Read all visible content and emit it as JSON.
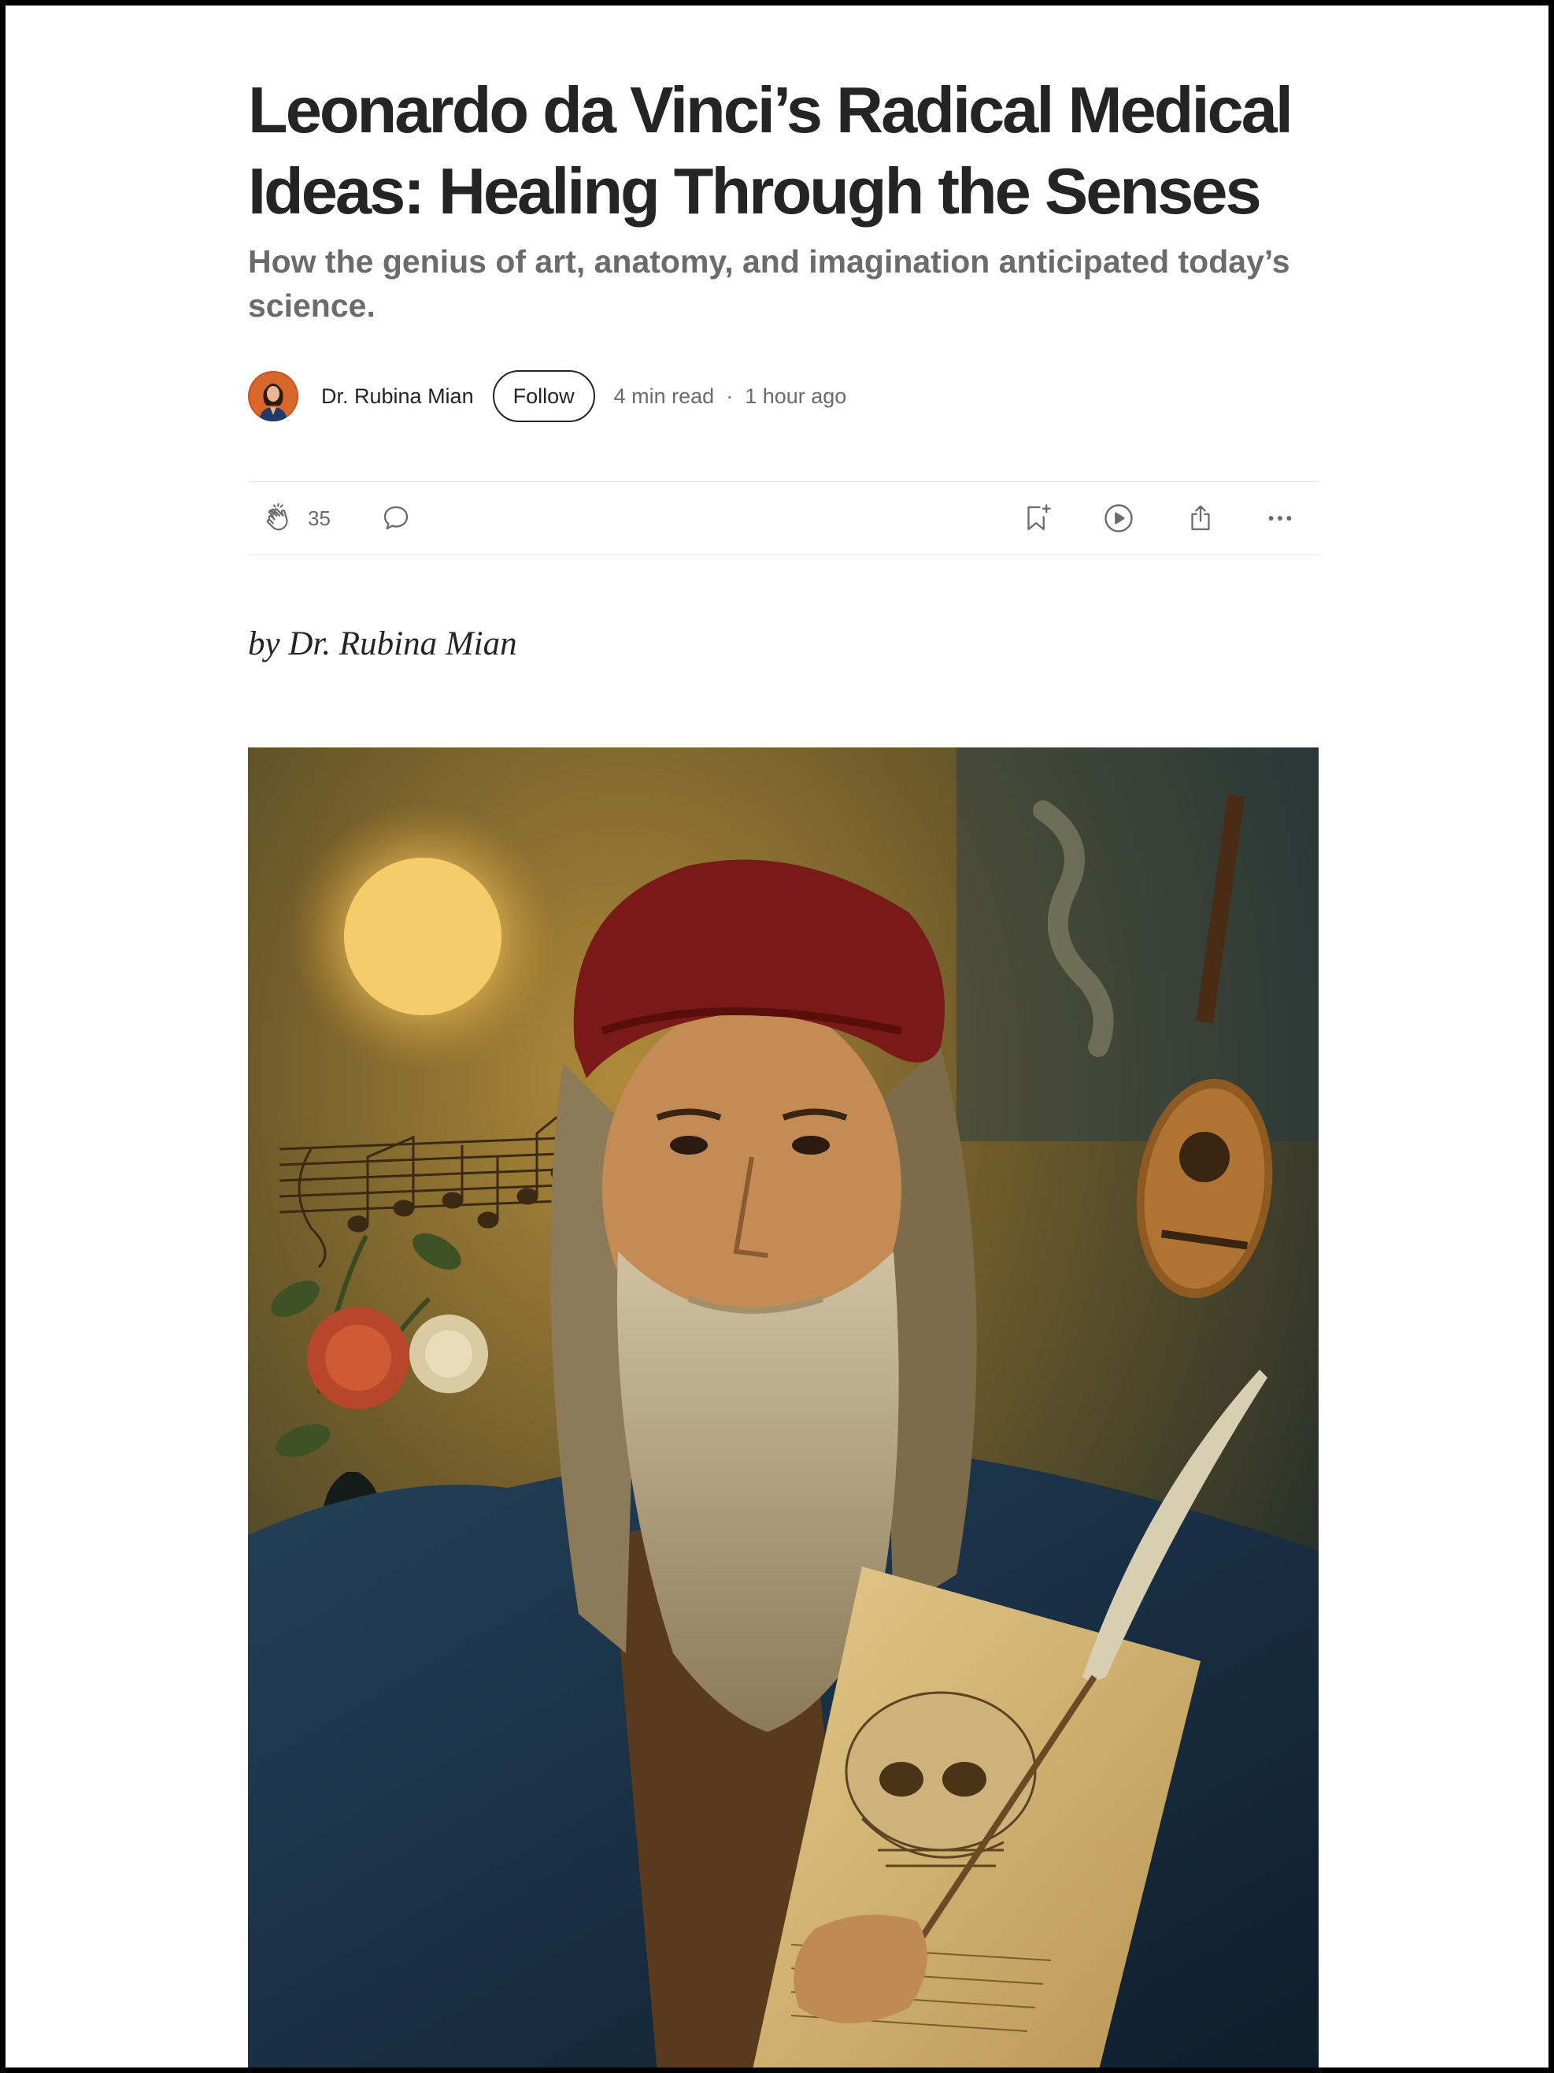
{
  "article": {
    "title": "Leonardo da Vinci’s Radical Medical Ideas: Healing Through the Senses",
    "subtitle": "How the genius of art, anatomy, and imagination anticipated today’s science.",
    "signature": "by Dr. Rubina Mian"
  },
  "byline": {
    "author_name": "Dr. Rubina Mian",
    "follow_label": "Follow",
    "read_time": "4 min read",
    "separator": "·",
    "published": "1 hour ago"
  },
  "actions": {
    "clap_count": "35",
    "icons": [
      "clap-icon",
      "comment-icon",
      "bookmark-add-icon",
      "play-icon",
      "share-icon",
      "more-icon"
    ]
  },
  "hero_image": {
    "subject": "painted portrait of an old bearded man in a red beret holding an anatomical skull drawing and a quill"
  },
  "colors": {
    "text": "#242424",
    "muted": "#6b6b6b",
    "divider": "#e6e6e6"
  }
}
